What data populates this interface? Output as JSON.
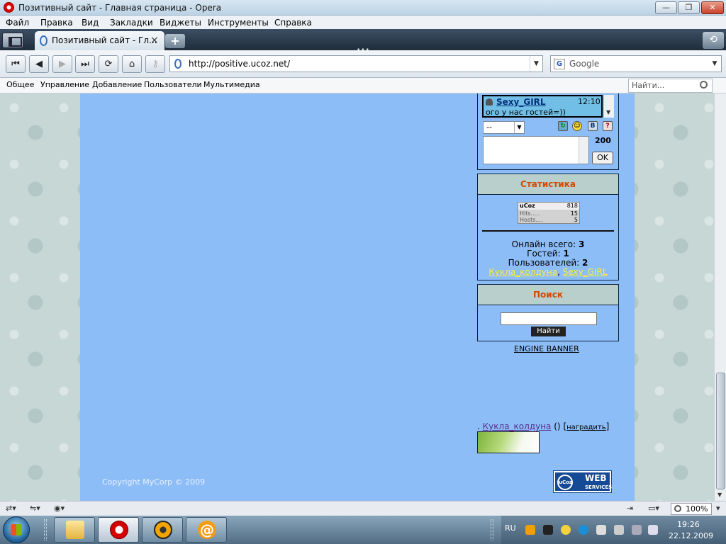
{
  "window": {
    "title": "Позитивный сайт - Главная страница - Opera"
  },
  "menu": [
    "Файл",
    "Правка",
    "Вид",
    "Закладки",
    "Виджеты",
    "Инструменты",
    "Справка"
  ],
  "tab": {
    "label": "Позитивный сайт - Гл...",
    "close": "×"
  },
  "address": {
    "url": "http://positive.ucoz.net/"
  },
  "search_engine": {
    "placeholder": "Google"
  },
  "site_nav": {
    "links": [
      "Общее",
      "Управление",
      "Добавление",
      "Пользователи",
      "Мультимедиа"
    ],
    "search_placeholder": "Найти..."
  },
  "chat": {
    "nick": "Sexy_GIRL",
    "time": "12:10",
    "message": "ого у нас гостей=))",
    "smile_select": "--",
    "counter": "200",
    "ok_label": "OK"
  },
  "stats": {
    "title": "Статистика",
    "counter": {
      "brand": "uCoz",
      "total": "818",
      "hits_label": "Hits.....",
      "hits": "15",
      "hosts_label": "Hosts....",
      "hosts": "5"
    },
    "online_label": "Онлайн всего:",
    "online_value": "3",
    "guests_label": "Гостей:",
    "guests_value": "1",
    "users_label": "Пользователей:",
    "users_value": "2",
    "user1": "Кукла_колдуна",
    "separator": ",",
    "user2": "Sexy_GIRL"
  },
  "search_block": {
    "title": "Поиск",
    "button": "Найти"
  },
  "engine_banner": "ENGINE BANNER",
  "award": {
    "prefix": ".",
    "user": "Кукла_колдуна",
    "count": "()",
    "reward_label": "наградить",
    "open": "[",
    "close": "]"
  },
  "footer": {
    "copyright": "Copyright MyCorp © 2009"
  },
  "ucoz_badge": {
    "circle": "uCoz",
    "line1": "WEB",
    "line2": "SERVICES"
  },
  "status": {
    "zoom": "100%"
  },
  "tray": {
    "lang": "RU",
    "time": "19:26",
    "date": "22.12.2009"
  },
  "colors": {
    "content_bg": "#8dbdf7",
    "block_title": "#d24a00",
    "online_link": "#ffee33"
  }
}
